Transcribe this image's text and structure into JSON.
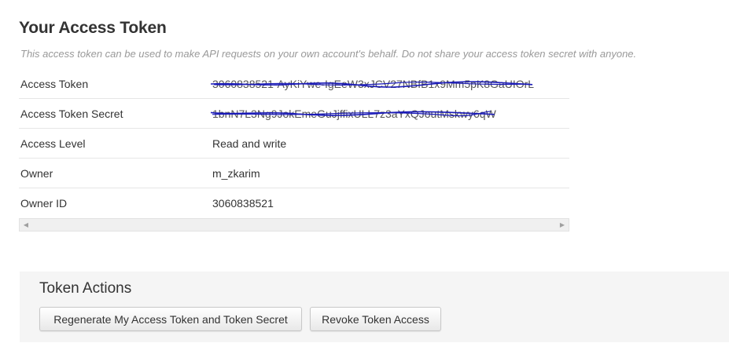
{
  "header": {
    "title": "Your Access Token",
    "subtitle": "This access token can be used to make API requests on your own account's behalf. Do not share your access token secret with anyone."
  },
  "token_details": {
    "rows": [
      {
        "label": "Access Token",
        "value": "3060838521-AyKiYwe-IgEeW3xJCV27NBfB1x9Mm5pK8GaUIOrL",
        "redacted": true
      },
      {
        "label": "Access Token Secret",
        "value": "1bnN7L3Ng9JokEmeGuJjffixULL7z3aYxQJoutMskwy6qW",
        "redacted": true
      },
      {
        "label": "Access Level",
        "value": "Read and write",
        "redacted": false
      },
      {
        "label": "Owner",
        "value": "m_zkarim",
        "redacted": false
      },
      {
        "label": "Owner ID",
        "value": "3060838521",
        "redacted": false
      }
    ]
  },
  "scrollbar": {
    "left_arrow": "left-arrow-icon",
    "right_arrow": "right-arrow-icon"
  },
  "token_actions": {
    "title": "Token Actions",
    "regenerate_label": "Regenerate My Access Token and Token Secret",
    "revoke_label": "Revoke Token Access"
  },
  "colors": {
    "scribble": "#1a1ab8",
    "panel_bg": "#f5f5f5",
    "subtitle": "#999999"
  }
}
